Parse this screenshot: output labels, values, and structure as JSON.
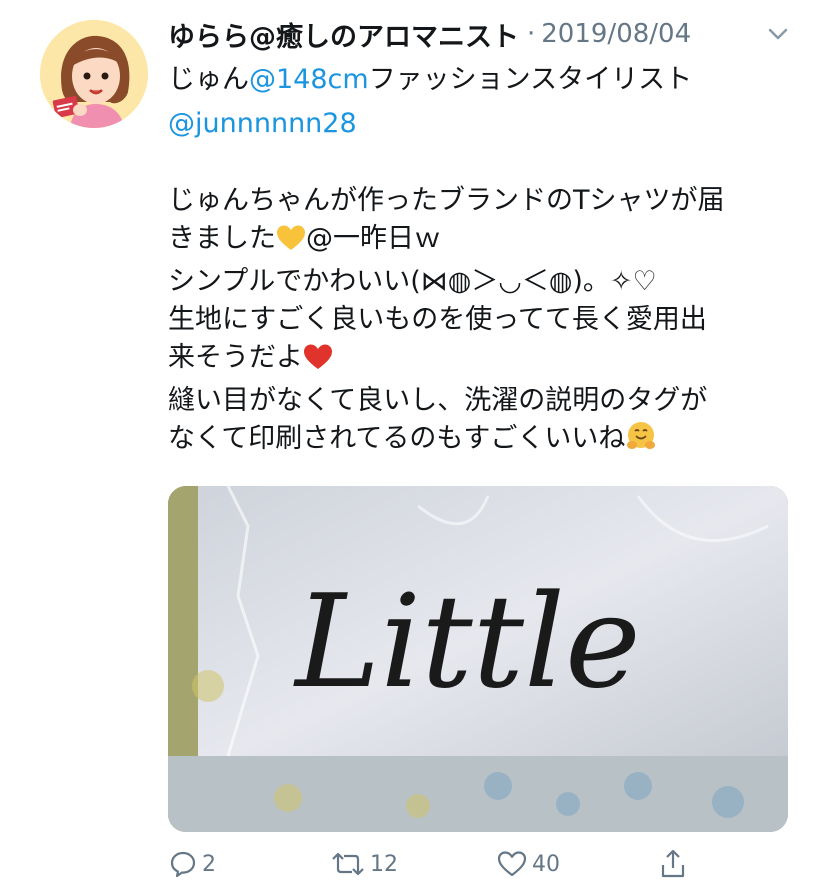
{
  "tweet": {
    "display_name": "ゆらら@癒しのアロマニスト",
    "separator": "·",
    "timestamp": "2019/08/04",
    "reply_prefix": "じゅん",
    "reply_mention": "@148cm",
    "reply_suffix": "ファッションスタイリスト",
    "reply_handle": "@junnnnnn28",
    "text_lines": [
      "じゅんちゃんが作ったブランドのTシャツが届",
      "きました",
      "@一昨日ｗ",
      "シンプルでかわいい(⋈◍＞◡＜◍)。✧♡",
      "生地にすごく良いものを使ってて長く愛用出",
      "来そうだよ",
      "縫い目がなくて良いし、洗濯の説明のタグが",
      "なくて印刷されてるのもすごくいいね"
    ],
    "image_text": "Little",
    "icons": {
      "chevron": "chevron-down-icon",
      "reply": "reply-icon",
      "retweet": "retweet-icon",
      "like": "heart-icon",
      "share": "share-icon"
    }
  },
  "actions": {
    "reply_count": "2",
    "retweet_count": "12",
    "like_count": "40"
  },
  "colors": {
    "link": "#1b95e0",
    "muted": "#657786",
    "text": "#14171a"
  }
}
